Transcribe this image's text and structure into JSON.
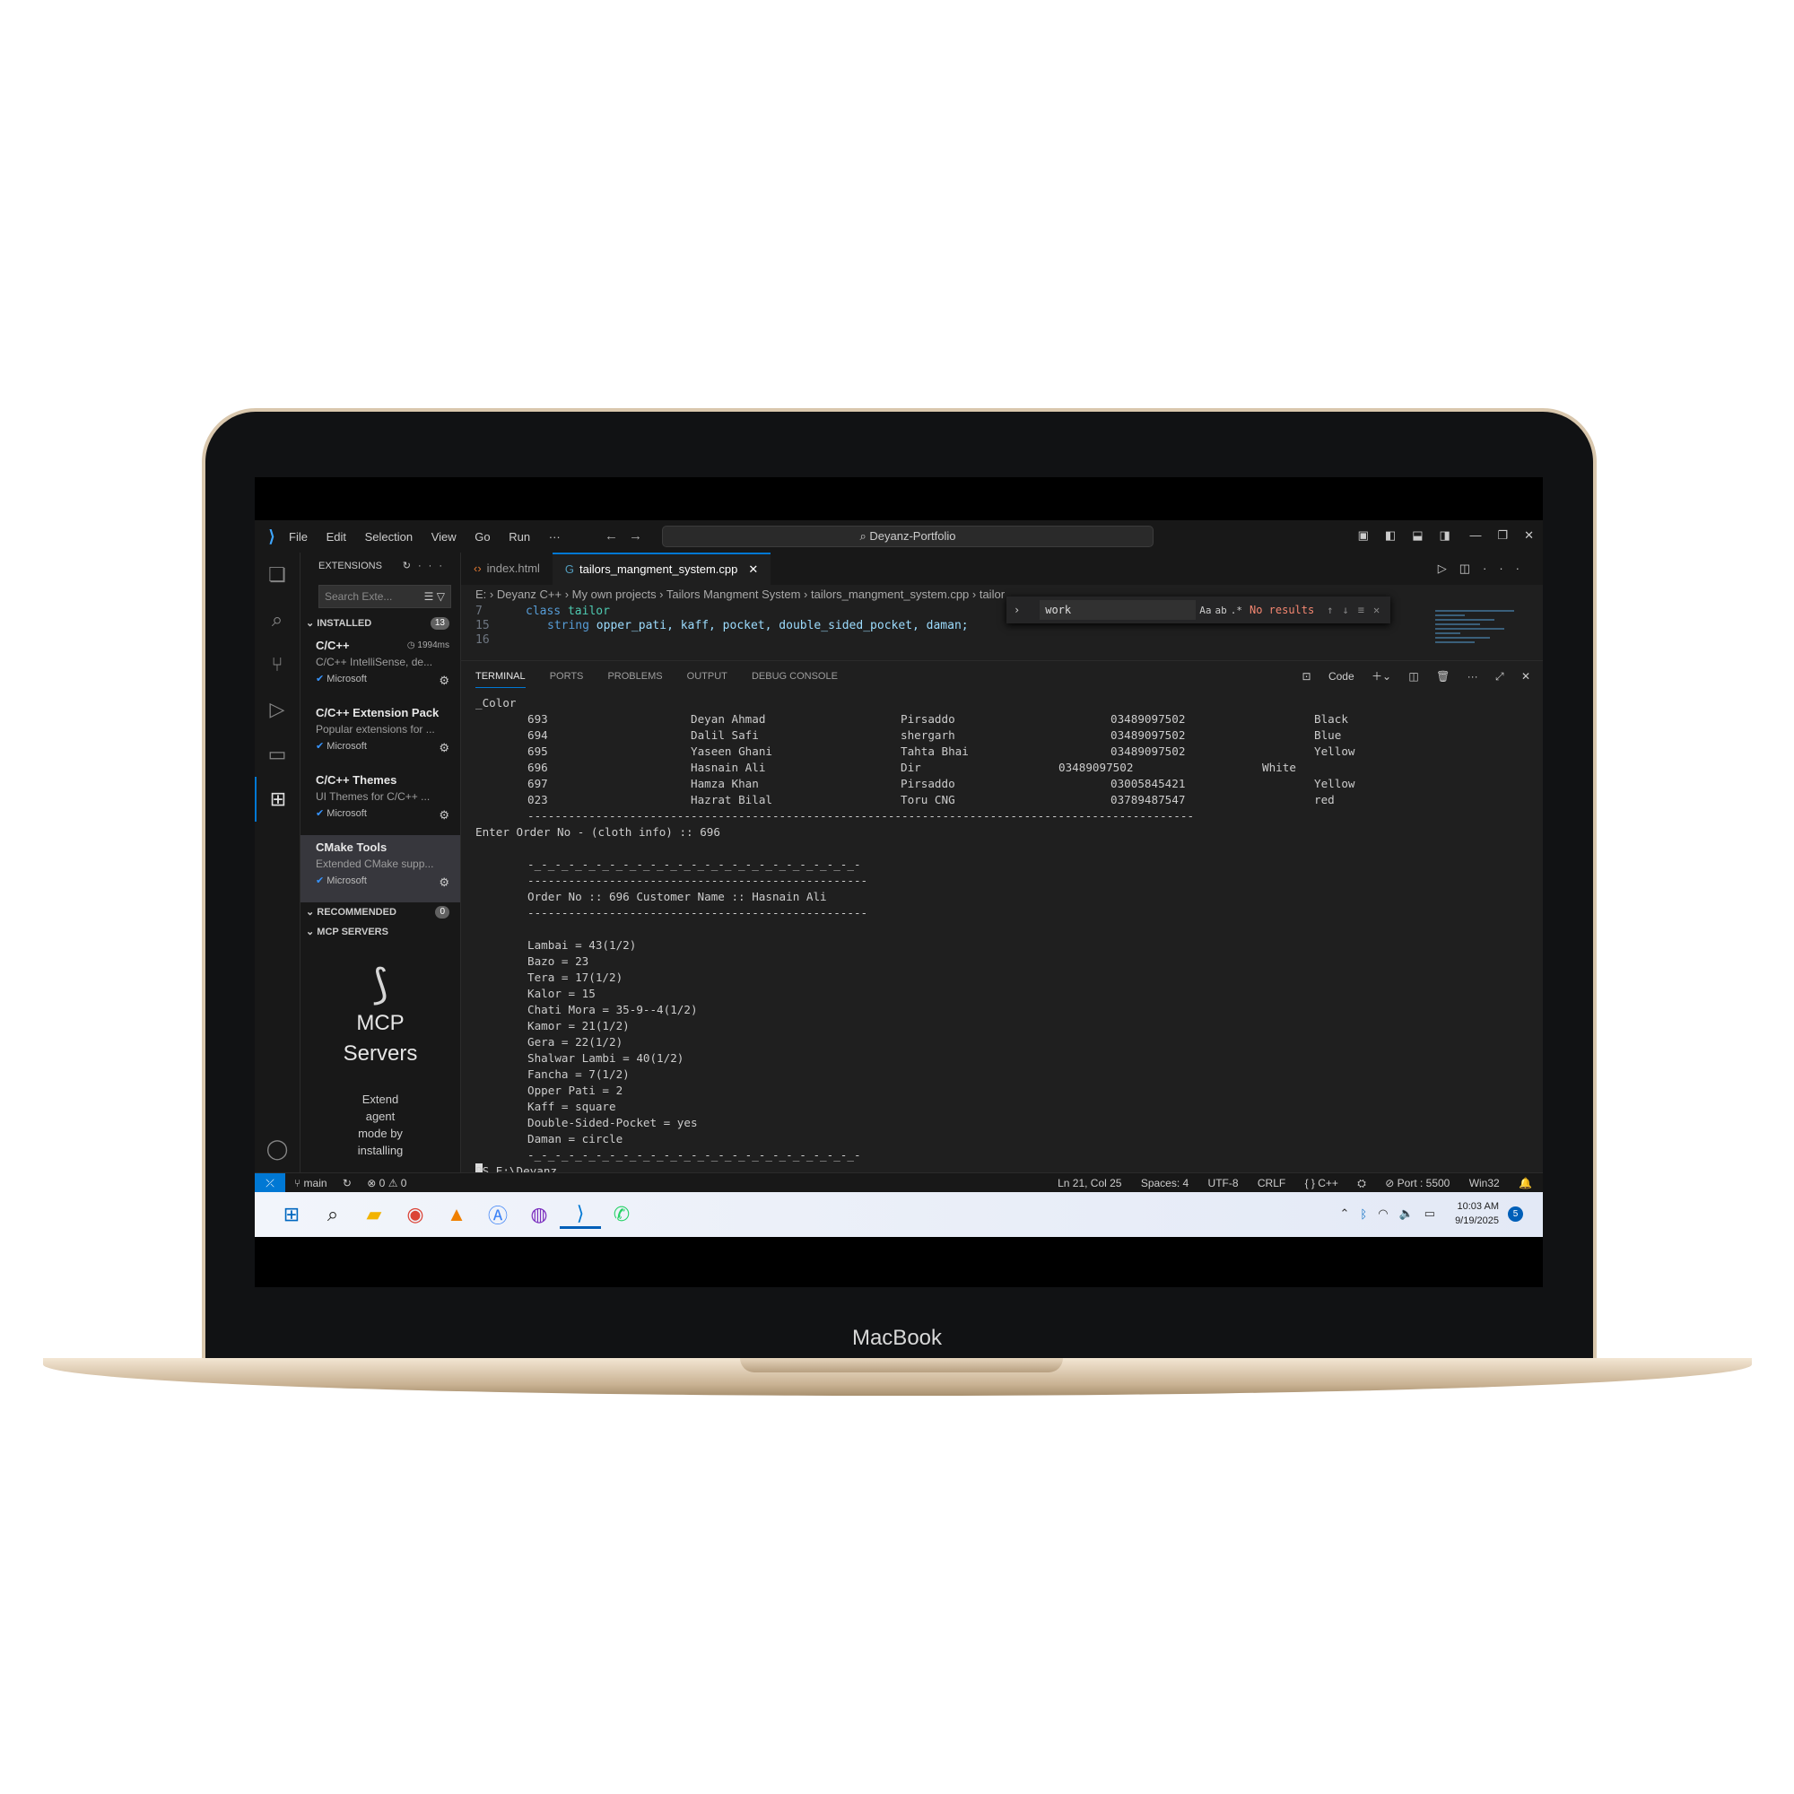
{
  "device": {
    "brand": "MacBook"
  },
  "titlebar": {
    "menu": [
      "File",
      "Edit",
      "Selection",
      "View",
      "Go",
      "Run",
      "···"
    ],
    "search": "Deyanz-Portfolio"
  },
  "sidebar": {
    "title": "EXTENSIONS",
    "search_placeholder": "Search Exte...",
    "installed_label": "INSTALLED",
    "installed_count": "13",
    "extensions": [
      {
        "name": "C/C++",
        "desc": "C/C++ IntelliSense, de...",
        "publisher": "Microsoft",
        "time": "1994ms"
      },
      {
        "name": "C/C++ Extension Pack",
        "desc": "Popular extensions for ...",
        "publisher": "Microsoft"
      },
      {
        "name": "C/C++ Themes",
        "desc": "UI Themes for C/C++ ...",
        "publisher": "Microsoft"
      },
      {
        "name": "CMake Tools",
        "desc": "Extended CMake supp...",
        "publisher": "Microsoft"
      }
    ],
    "recommended_label": "RECOMMENDED",
    "recommended_count": "0",
    "mcp_label": "MCP SERVERS",
    "mcp_title_1": "MCP",
    "mcp_title_2": "Servers",
    "mcp_desc": [
      "Extend",
      "agent",
      "mode by",
      "installing"
    ]
  },
  "editor": {
    "tabs": [
      {
        "label": "index.html"
      },
      {
        "label": "tailors_mangment_system.cpp"
      }
    ],
    "breadcrumb": "E: › Deyanz C++ › My own projects › Tailors Mangment System › tailors_mangment_system.cpp › tailor",
    "code_lines": [
      {
        "num": "7",
        "keyword": "class",
        "name": "tailor",
        "rest": ""
      },
      {
        "num": "15",
        "keyword": "string",
        "name": "",
        "rest": "opper_pati, kaff, pocket, double_sided_pocket, daman;"
      },
      {
        "num": "16",
        "keyword": "",
        "name": "",
        "rest": ""
      }
    ],
    "find": {
      "value": "work",
      "result": "No results"
    }
  },
  "panel": {
    "tabs": [
      "TERMINAL",
      "PORTS",
      "PROBLEMS",
      "OUTPUT",
      "DEBUG CONSOLE"
    ],
    "shell": "Code",
    "terminal": {
      "header": "_Color",
      "orders": [
        {
          "no": "693",
          "name": "Deyan Ahmad",
          "address": "Pirsaddo",
          "phone": "03489097502",
          "color": "Black"
        },
        {
          "no": "694",
          "name": "Dalil Safi",
          "address": "shergarh",
          "phone": "03489097502",
          "color": "Blue"
        },
        {
          "no": "695",
          "name": "Yaseen Ghani",
          "address": "Tahta Bhai",
          "phone": "03489097502",
          "color": "Yellow"
        },
        {
          "no": "696",
          "name": "Hasnain Ali",
          "address": "Dir",
          "phone": "03489097502",
          "color": "White"
        },
        {
          "no": "697",
          "name": "Hamza Khan",
          "address": "Pirsaddo",
          "phone": "03005845421",
          "color": "Yellow"
        },
        {
          "no": "023",
          "name": "Hazrat Bilal",
          "address": "Toru CNG",
          "phone": "03789487547",
          "color": "red"
        }
      ],
      "rule_long": "--------------------------------------------------------------------------------------------------",
      "prompt_order": "Enter Order No - (cloth info) :: 696",
      "rule_dashed": "-_-_-_-_-_-_-_-_-_-_-_-_-_-_-_-_-_-_-_-_-_-_-_-_-",
      "rule_mid": "--------------------------------------------------",
      "order_line": "Order No :: 696        Customer Name :: Hasnain Ali",
      "measurements": [
        "Lambai = 43(1/2)",
        "Bazo = 23",
        "Tera = 17(1/2)",
        "Kalor = 15",
        "Chati Mora = 35-9--4(1/2)",
        "Kamor = 21(1/2)",
        "Gera = 22(1/2)",
        "Shalwar Lambi = 40(1/2)",
        "Fancha = 7(1/2)",
        "Opper Pati = 2",
        "Kaff = square",
        "Double-Sided-Pocket = yes",
        "Daman = circle"
      ],
      "prompt": "PS E:\\Deyanz C++\\My own projects\\Tailors Mangment System>"
    }
  },
  "statusbar": {
    "branch": "main",
    "problems": "⊗ 0 ⚠ 0",
    "position": "Ln 21, Col 25",
    "spaces": "Spaces: 4",
    "encoding": "UTF-8",
    "eol": "CRLF",
    "language": "{ } C++",
    "port": "⊘ Port : 5500",
    "platform": "Win32"
  },
  "taskbar": {
    "time": "10:03 AM",
    "date": "9/19/2025",
    "notification": "5"
  },
  "colors": {
    "accent": "#0078d4",
    "editor_bg": "#1f1f1f",
    "sidebar_bg": "#181818",
    "no_results": "#f48771"
  }
}
